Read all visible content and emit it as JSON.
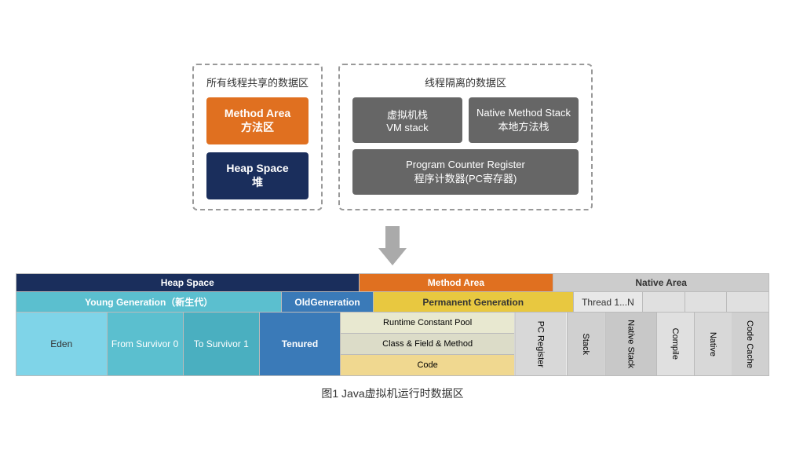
{
  "top": {
    "shared_label": "所有线程共享的数据区",
    "isolated_label": "线程隔离的数据区",
    "method_area_line1": "Method Area",
    "method_area_line2": "方法区",
    "heap_space_line1": "Heap Space",
    "heap_space_line2": "堆",
    "vm_stack_line1": "虚拟机栈",
    "vm_stack_line2": "VM stack",
    "native_stack_line1": "Native Method Stack",
    "native_stack_line2": "本地方法栈",
    "pc_register_line1": "Program Counter Register",
    "pc_register_line2": "程序计数器(PC寄存器)"
  },
  "bottom": {
    "heap_space": "Heap Space",
    "method_area": "Method Area",
    "native_area": "Native Area",
    "young_gen": "Young Generation（新生代）",
    "old_gen_line1": "Old",
    "old_gen_line2": "Generation",
    "perm_gen": "Permanent Generation",
    "thread": "Thread 1...N",
    "eden": "Eden",
    "from_survivor": "From Survivor 0",
    "to_survivor": "To Survivor 1",
    "tenured": "Tenured",
    "runtime_constant": "Runtime Constant Pool",
    "class_field": "Class & Field & Method",
    "code": "Code",
    "pc_register": "PC Register",
    "stack": "Stack",
    "native_stack": "Native Stack",
    "compile": "Compile",
    "native2": "Native",
    "code_cache": "Code Cache"
  },
  "caption": "图1  Java虚拟机运行时数据区"
}
